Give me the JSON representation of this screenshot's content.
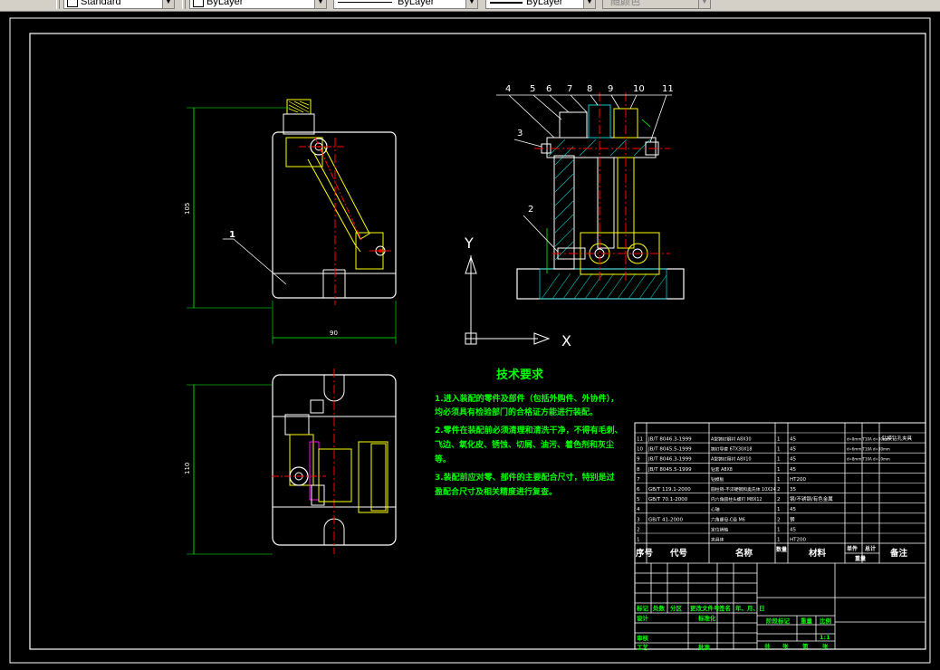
{
  "toolbar": {
    "text_style": "Standard",
    "layer_control": "ByLayer",
    "linetype_control": "ByLayer",
    "lineweight_control": "ByLayer",
    "plotstyle_control": "随颜色"
  },
  "drawing": {
    "front_view": {
      "part_label": "1",
      "dim_height": "105",
      "dim_width": "90"
    },
    "top_view": {
      "dim_height": "110"
    },
    "side_view": {
      "balloons": [
        "4",
        "5",
        "6",
        "7",
        "8",
        "9",
        "10",
        "11",
        "3",
        "2"
      ]
    },
    "ucs": {
      "x_label": "X",
      "y_label": "Y"
    },
    "tech_requirements": {
      "title": "技术要求",
      "lines": [
        "1.进入装配的零件及部件（包括外购件、外协件），",
        "均必须具有检验部门的合格证方能进行装配。",
        "2.零件在装配前必须清理和清洗干净，不得有毛刺、",
        "飞边、氧化皮、锈蚀、切屑、油污、着色剂和灰尘",
        "等。",
        "3.装配前应对零、部件的主要配合尺寸，特别是过",
        "盈配合尺寸及相关精度进行复查。"
      ]
    },
    "bom": {
      "rows": [
        [
          "11",
          "JB/T 8046.3-1999",
          "A型铸钉钢衬 A8X30",
          "1",
          "45",
          "d=8mm,T10A d=30mm"
        ],
        [
          "10",
          "JB/T 8045.5-1999",
          "铸钉导套 6TX30X18",
          "1",
          "45",
          "d=6mm,T10A d=30mm"
        ],
        [
          "9",
          "JB/T 8046.3-1999",
          "A型铸钉用衬 A8X10",
          "1",
          "45",
          "d=8mm,T10A d=10mm"
        ],
        [
          "8",
          "JB/T 8045.5-1999",
          "钻套 A8X8",
          "1",
          "45",
          ""
        ],
        [
          "7",
          "",
          "钻模板",
          "1",
          "HT200",
          ""
        ],
        [
          "6",
          "GB/T 119.1-2000",
          "圆柱销-不淬硬钢和奥氏体 10X24",
          "2",
          "35",
          ""
        ],
        [
          "5",
          "GB/T 70.1-2000",
          "内六角圆柱头螺钉 M8X12",
          "2",
          "钢/不锈钢/有色金属",
          ""
        ],
        [
          "4",
          "",
          "心轴",
          "1",
          "45",
          ""
        ],
        [
          "3",
          "GB/T 41-2000",
          "六角螺母-C级 M6",
          "2",
          "钢",
          ""
        ],
        [
          "2",
          "",
          "定位销轴",
          "1",
          "45",
          ""
        ],
        [
          "1",
          "",
          "夹具体",
          "1",
          "HT200",
          ""
        ]
      ],
      "side_note": "钻模钻孔夹具",
      "header": {
        "no": "序号",
        "code": "代号",
        "name": "名称",
        "qty": "数量",
        "material": "材料",
        "unit": "单件",
        "total": "总计",
        "weight": "重量",
        "remark": "备注"
      }
    },
    "title_block": {
      "mark": "标记",
      "count": "处数",
      "zone": "分区",
      "change_doc": "更改文件号",
      "sign": "签名",
      "date": "年、月、日",
      "design": "设计",
      "standardize": "标准化",
      "review": "审核",
      "process": "工艺",
      "approve": "批准",
      "stage_mark": "阶段标记",
      "weight": "重量",
      "scale": "比例",
      "scale_value": "1:1",
      "sheets_total": "共",
      "sheet_label": "张",
      "sheet_no": "第",
      "sheet_label2": "张"
    }
  }
}
